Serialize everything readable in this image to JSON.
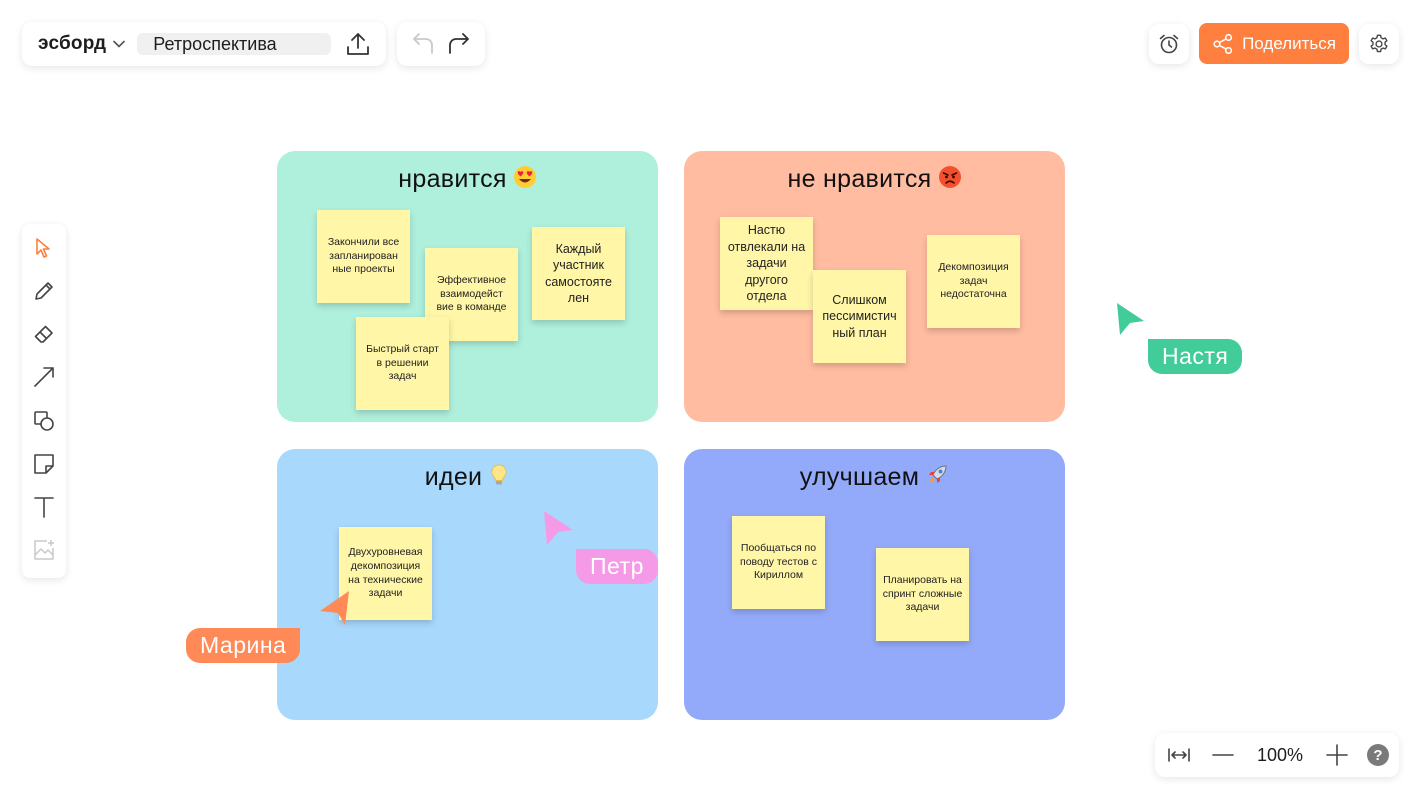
{
  "header": {
    "brand": "эсборд",
    "board_title": "Ретроспектива",
    "share_label": "Поделиться"
  },
  "toolbar": {
    "tools": [
      "select-icon",
      "pen-icon",
      "eraser-icon",
      "line-icon",
      "shapes-icon",
      "sticky-note-icon",
      "text-icon",
      "image-icon"
    ],
    "active_tool": "select-icon",
    "text_tool_glyph": "T"
  },
  "zones": {
    "like": {
      "title": "нравится",
      "emoji": "😍",
      "notes": [
        "Закончили все запланирован ные проекты",
        "Эффективное взаимодейст вие в команде",
        "Каждый участник самостояте лен",
        "Быстрый старт в решении задач"
      ]
    },
    "dislike": {
      "title": "не нравится",
      "emoji": "😡",
      "notes": [
        "Настю отвлекали на задачи другого отдела",
        "Слишком пессимистич ный план",
        "Декомпозиция задач недостаточна"
      ]
    },
    "ideas": {
      "title": "идеи",
      "emoji": "💡",
      "notes": [
        "Двухуровневая декомпозиция на технические задачи"
      ]
    },
    "improve": {
      "title": "улучшаем",
      "emoji": "🚀",
      "notes": [
        "Пообщаться по поводу тестов с Кириллом",
        "Планировать на спринт сложные задачи"
      ]
    }
  },
  "cursors": [
    {
      "name": "Настя",
      "color": "#41cc9a"
    },
    {
      "name": "Петр",
      "color": "#f59ae6"
    },
    {
      "name": "Марина",
      "color": "#ff8a57"
    }
  ],
  "zoom": {
    "level": "100%",
    "help": "?"
  },
  "colors": {
    "accent": "#ff7f3f",
    "zone_like": "#aef0dc",
    "zone_dislike": "#ffbca0",
    "zone_ideas": "#a8d8fc",
    "zone_improve": "#93aafa",
    "sticky": "#fff6a8"
  }
}
